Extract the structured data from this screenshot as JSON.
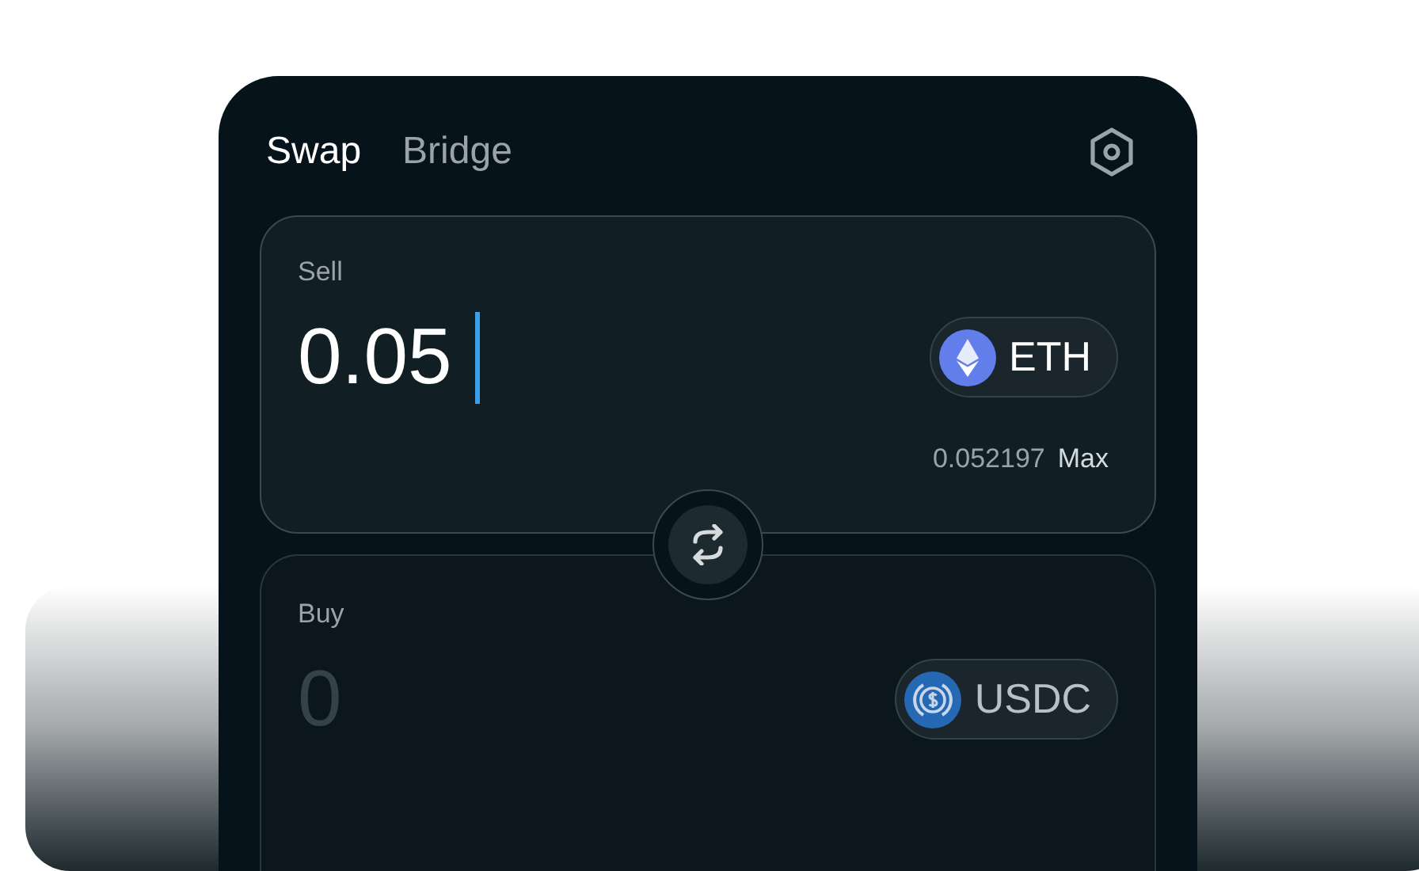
{
  "tabs": [
    {
      "label": "Swap",
      "selected": true
    },
    {
      "label": "Bridge",
      "selected": false
    }
  ],
  "sell": {
    "label": "Sell",
    "value": "0.05",
    "token": {
      "symbol": "ETH",
      "kind": "eth"
    },
    "balance": "0.052197",
    "max_label": "Max"
  },
  "buy": {
    "label": "Buy",
    "placeholder": "0",
    "token": {
      "symbol": "USDC",
      "kind": "usdc"
    }
  }
}
